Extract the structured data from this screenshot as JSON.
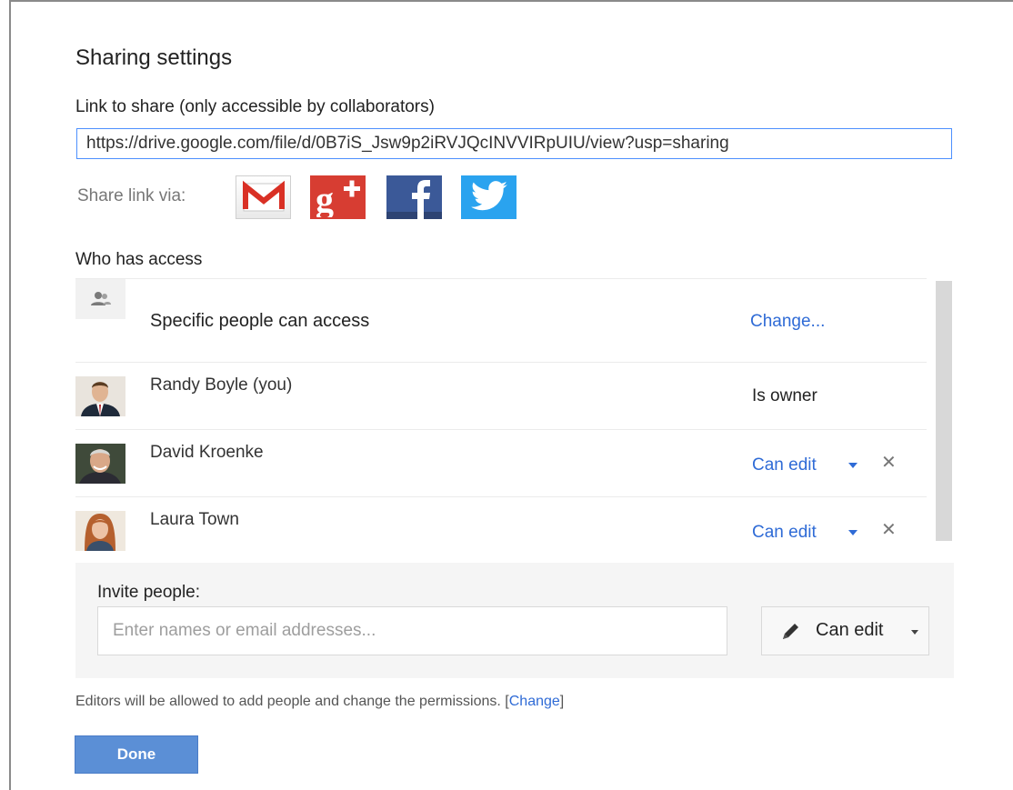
{
  "dialog": {
    "title": "Sharing settings",
    "link_label": "Link to share (only accessible by collaborators)",
    "link_url": "https://drive.google.com/file/d/0B7iS_Jsw9p2iRVJQcINVVIRpUIU/view?usp=sharing",
    "share_via_label": "Share link via:",
    "share_targets": [
      {
        "name": "Gmail",
        "icon": "gmail-icon",
        "color": "#d93025"
      },
      {
        "name": "Google+",
        "icon": "google-plus-icon",
        "color": "#d73d32"
      },
      {
        "name": "Facebook",
        "icon": "facebook-icon",
        "color": "#3b5998"
      },
      {
        "name": "Twitter",
        "icon": "twitter-icon",
        "color": "#2aa3ef"
      }
    ],
    "who_has_access_label": "Who has access"
  },
  "access": {
    "general": {
      "icon": "people-icon",
      "label": "Specific people can access",
      "change_label": "Change..."
    },
    "people": [
      {
        "name": "Randy Boyle (you)",
        "role": "Is owner",
        "removable": false
      },
      {
        "name": "David Kroenke",
        "role": "Can edit",
        "removable": true
      },
      {
        "name": "Laura Town",
        "role": "Can edit",
        "removable": true
      }
    ],
    "remove_glyph": "✕"
  },
  "invite": {
    "label": "Invite people:",
    "placeholder": "Enter names or email addresses...",
    "permission_label": "Can edit",
    "permission_icon": "pencil-icon"
  },
  "footer": {
    "editors_note": "Editors will be allowed to add people and change the permissions.",
    "bracket_open": "[",
    "change_label": "Change",
    "bracket_close": "]",
    "done_label": "Done"
  },
  "colors": {
    "link_blue": "#2f6bd6",
    "done_button": "#5b8fd6",
    "focus_border": "#4d90fe"
  }
}
